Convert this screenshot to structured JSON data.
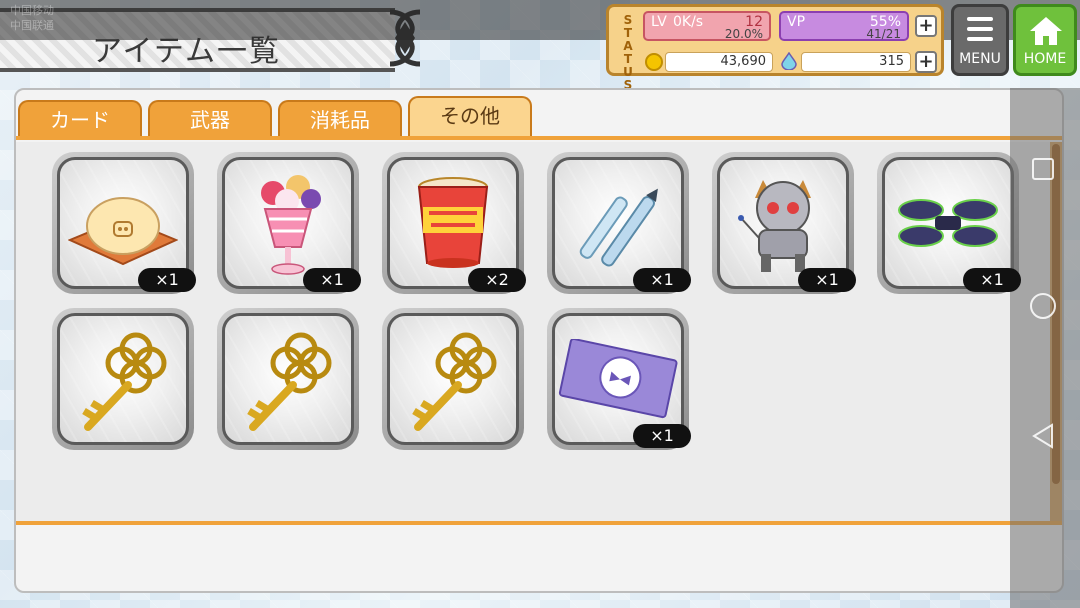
{
  "system": {
    "carrier_line1": "中国移动",
    "carrier_line2": "中国联通"
  },
  "header": {
    "title": "アイテム一覧"
  },
  "status": {
    "label": "STATUS",
    "lv_label": "LV",
    "lv_net": "0K/s",
    "lv_value": "12",
    "lv_progress": "20.0%",
    "vp_label": "VP",
    "vp_battery": "55%",
    "vp_value": "41/21",
    "coins": "43,690",
    "gems": "315",
    "plus": "+"
  },
  "menu": {
    "label": "MENU"
  },
  "home": {
    "label": "HOME"
  },
  "tabs": [
    {
      "label": "カード"
    },
    {
      "label": "武器"
    },
    {
      "label": "消耗品"
    },
    {
      "label": "その他",
      "active": true
    }
  ],
  "items": [
    {
      "name": "pork-bun-item",
      "count": "×1"
    },
    {
      "name": "parfait-item",
      "count": "×1"
    },
    {
      "name": "cup-noodle-item",
      "count": "×2"
    },
    {
      "name": "pens-item",
      "count": "×1"
    },
    {
      "name": "robot-cat-item",
      "count": "×1"
    },
    {
      "name": "drone-item",
      "count": "×1"
    },
    {
      "name": "gold-key-item",
      "count": ""
    },
    {
      "name": "gold-key-item",
      "count": ""
    },
    {
      "name": "gold-key-item",
      "count": ""
    },
    {
      "name": "ticket-item",
      "count": "×1"
    }
  ],
  "colors": {
    "accent": "#f0a23a",
    "tab_active": "#fbd58f",
    "home": "#6fc13c"
  }
}
